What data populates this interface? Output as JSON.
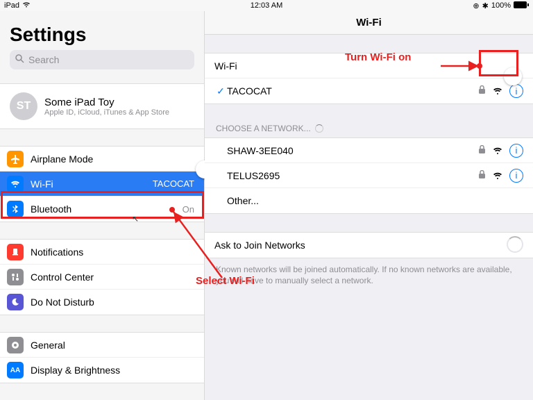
{
  "status": {
    "device": "iPad",
    "time": "12:03 AM",
    "battery": "100%"
  },
  "sidebar": {
    "title": "Settings",
    "search_placeholder": "Search",
    "account": {
      "initials": "ST",
      "name": "Some iPad Toy",
      "subtitle": "Apple ID, iCloud, iTunes & App Store"
    },
    "group1": {
      "airplane": {
        "label": "Airplane Mode"
      },
      "wifi": {
        "label": "Wi-Fi",
        "value": "TACOCAT"
      },
      "bluetooth": {
        "label": "Bluetooth",
        "value": "On"
      }
    },
    "group2": {
      "notifications": {
        "label": "Notifications"
      },
      "control_center": {
        "label": "Control Center"
      },
      "dnd": {
        "label": "Do Not Disturb"
      }
    },
    "group3": {
      "general": {
        "label": "General"
      },
      "display": {
        "label": "Display & Brightness"
      }
    }
  },
  "detail": {
    "page_title": "Wi-Fi",
    "wifi_toggle_label": "Wi-Fi",
    "connected_network": "TACOCAT",
    "choose_header": "CHOOSE A NETWORK...",
    "networks": [
      {
        "name": "SHAW-3EE040",
        "locked": true
      },
      {
        "name": "TELUS2695",
        "locked": true
      }
    ],
    "other": "Other...",
    "ask_label": "Ask to Join Networks",
    "ask_hint": "Known networks will be joined automatically. If no known networks are available, you will have to manually select a network."
  },
  "callouts": {
    "turn_on": "Turn Wi-Fi on",
    "select": "Select Wi-Fi"
  },
  "colors": {
    "airplane": "#ff9500",
    "wifi": "#007aff",
    "bluetooth": "#007aff",
    "notifications": "#ff3b30",
    "control_center": "#8e8e93",
    "dnd": "#5956d6",
    "general": "#8e8e93",
    "display": "#007aff"
  }
}
